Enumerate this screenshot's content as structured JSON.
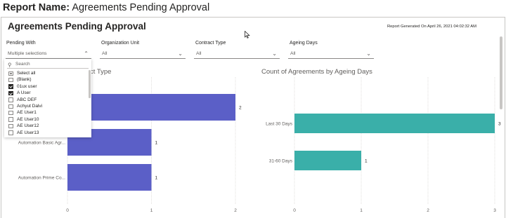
{
  "header": {
    "report_name_label": "Report Name:",
    "report_name_value": "Agreements Pending Approval"
  },
  "page": {
    "title": "Agreements Pending Approval",
    "generated": "Report Generated On April 26, 2021 04:02:32 AM"
  },
  "slicers": [
    {
      "label": "Pending With",
      "value": "Multiple selections",
      "chevron": "chevron-up-icon"
    },
    {
      "label": "Organization Unit",
      "value": "All",
      "chevron": "chevron-down-icon"
    },
    {
      "label": "Contract Type",
      "value": "All",
      "chevron": "chevron-down-icon"
    },
    {
      "label": "Ageing Days",
      "value": "All",
      "chevron": "chevron-down-icon"
    }
  ],
  "dropdown": {
    "search_placeholder": "Search",
    "items": [
      {
        "label": "Select all",
        "checked": false,
        "partial": true
      },
      {
        "label": "(Blank)",
        "checked": false
      },
      {
        "label": "01ux user",
        "checked": true
      },
      {
        "label": "A User",
        "checked": true
      },
      {
        "label": "ABC DEF",
        "checked": false
      },
      {
        "label": "Achyut Dalvi",
        "checked": false
      },
      {
        "label": "AE User1",
        "checked": false
      },
      {
        "label": "AE User10",
        "checked": false
      },
      {
        "label": "AE User12",
        "checked": false
      },
      {
        "label": "AE User13",
        "checked": false
      }
    ]
  },
  "chart_data": [
    {
      "type": "bar",
      "orientation": "horizontal",
      "title": "Count of Agreements by Contract Type",
      "title_visible_fragment": "ct Type",
      "title_visible_initial": "C",
      "categories": [
        "",
        "Automation Basic Agr...",
        "Automation Prime Co..."
      ],
      "values": [
        2,
        1,
        1
      ],
      "xlim": [
        0,
        2
      ],
      "xticks": [
        0,
        1,
        2
      ],
      "color": "#5b5fc7",
      "grid": true
    },
    {
      "type": "bar",
      "orientation": "horizontal",
      "title": "Count of Agreements by Ageing Days",
      "categories": [
        "Last 30 Days",
        "31-60 Days"
      ],
      "values": [
        3,
        1
      ],
      "xlim": [
        0,
        3
      ],
      "xticks": [
        0,
        1,
        2,
        3
      ],
      "color": "#3aafa9",
      "grid": true
    }
  ]
}
